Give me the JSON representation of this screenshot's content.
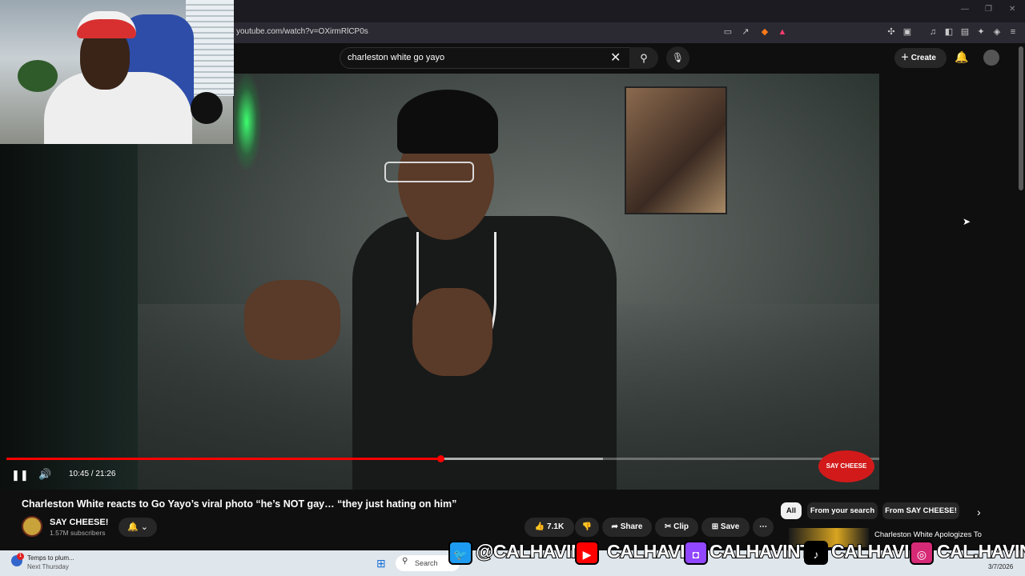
{
  "browser": {
    "url": "youtube.com/watch?v=OXirmRlCP0s"
  },
  "youtube": {
    "search_query": "charleston white go yayo",
    "create_label": "Create"
  },
  "player": {
    "current_time": "10:45",
    "duration": "21:26",
    "time_display": "10:45 / 21:26",
    "progress_fraction": 0.4972,
    "channel_logo_overlay": "SAY CHEESE"
  },
  "video": {
    "title": "Charleston White reacts to Go Yayo’s viral photo “he’s NOT gay… “they just hating on him”",
    "channel_name": "SAY CHEESE!",
    "subscribers": "1.57M subscribers",
    "likes": "7.1K",
    "share_label": "Share",
    "clip_label": "Clip",
    "save_label": "Save"
  },
  "chips": {
    "all": "All",
    "from_search": "From your search",
    "from_channel": "From SAY CHEESE!"
  },
  "related": {
    "title": "Charleston White Apologizes To"
  },
  "taskbar": {
    "notification_title": "Temps to plum...",
    "notification_sub": "Next Thursday",
    "notification_count": "1",
    "search_label": "Search",
    "date": "3/7/2026"
  },
  "socials": {
    "twitter": "@CALHAVIN",
    "youtube": "CALHAVIN",
    "twitch": "CALHAVINTV",
    "tiktok": "CALHAVIN",
    "instagram": "CAL.HAVIN"
  },
  "colors": {
    "progress": "#ff0000",
    "background": "#0f0f0f",
    "twitter": "#1d9bf0",
    "youtube": "#ff0000",
    "twitch": "#9146ff",
    "instagram": "#d62976"
  }
}
